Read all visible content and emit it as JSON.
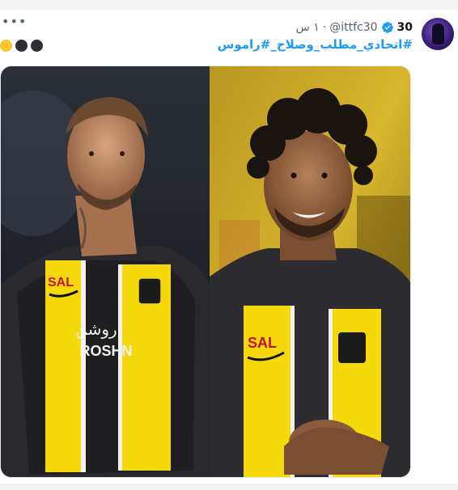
{
  "tweet": {
    "display_name": "30",
    "handle": "@ittfc30",
    "separator": "·",
    "time": "١ س",
    "verified_icon": "verified-badge-icon",
    "hashtags": "اتحادي_مطلب_وصلاح_#راموس#",
    "emojis": [
      "black-circle",
      "black-circle",
      "yellow-circle"
    ],
    "more_icon": "more-dots-icon"
  },
  "media": {
    "left_image": {
      "sponsor": "SAL",
      "kit_text_ar": "روشن",
      "kit_text_en": "ROSHN"
    },
    "right_image": {
      "sponsor": "SAL"
    }
  },
  "colors": {
    "link": "#1d9bf0",
    "kit_yellow": "#f5d90a",
    "kit_black": "#1d1d1d"
  }
}
